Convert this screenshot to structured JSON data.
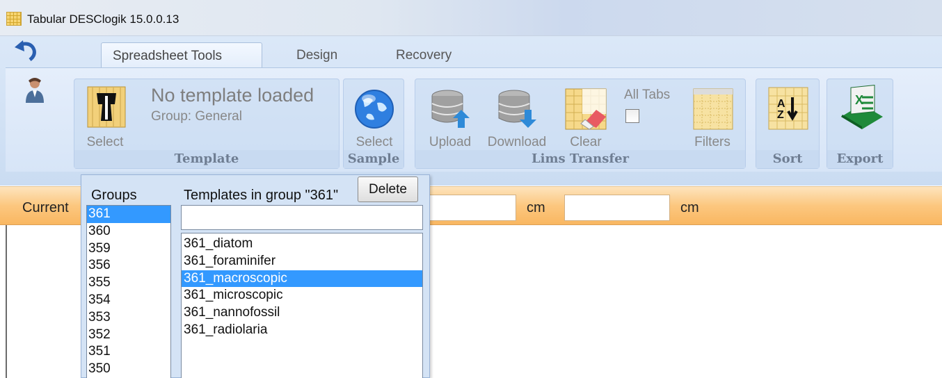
{
  "window": {
    "title": "Tabular DESClogik 15.0.0.13"
  },
  "ribbon": {
    "tabs": [
      {
        "label": "Spreadsheet Tools"
      },
      {
        "label": "Design"
      },
      {
        "label": "Recovery"
      }
    ],
    "groups": {
      "template": {
        "label": "Template",
        "select_label": "Select",
        "name": "No template loaded",
        "group_line": "Group: General"
      },
      "sample": {
        "label": "Sample",
        "select_label": "Select"
      },
      "lims": {
        "label": "Lims Transfer",
        "upload_label": "Upload",
        "download_label": "Download",
        "clear_label": "Clear",
        "all_tabs_label": "All Tabs",
        "filters_label": "Filters"
      },
      "sort": {
        "label": "Sort"
      },
      "export": {
        "label": "Export"
      }
    }
  },
  "current_bar": {
    "label": "Current",
    "unit_a": "cm",
    "unit_b": "cm"
  },
  "dropdown": {
    "groups_title": "Groups",
    "templates_title": "Templates in group \"361\"",
    "delete_label": "Delete",
    "groups": [
      "361",
      "360",
      "359",
      "356",
      "355",
      "354",
      "353",
      "352",
      "351",
      "350"
    ],
    "selected_group": "361",
    "templates": [
      "361_diatom",
      "361_foraminifer",
      "361_macroscopic",
      "361_microscopic",
      "361_nannofossil",
      "361_radiolaria"
    ],
    "selected_template": "361_macroscopic"
  },
  "colors": {
    "selection": "#3399ff",
    "ribbon": "#d7e5f7",
    "current_bar": "#fcc77f"
  }
}
